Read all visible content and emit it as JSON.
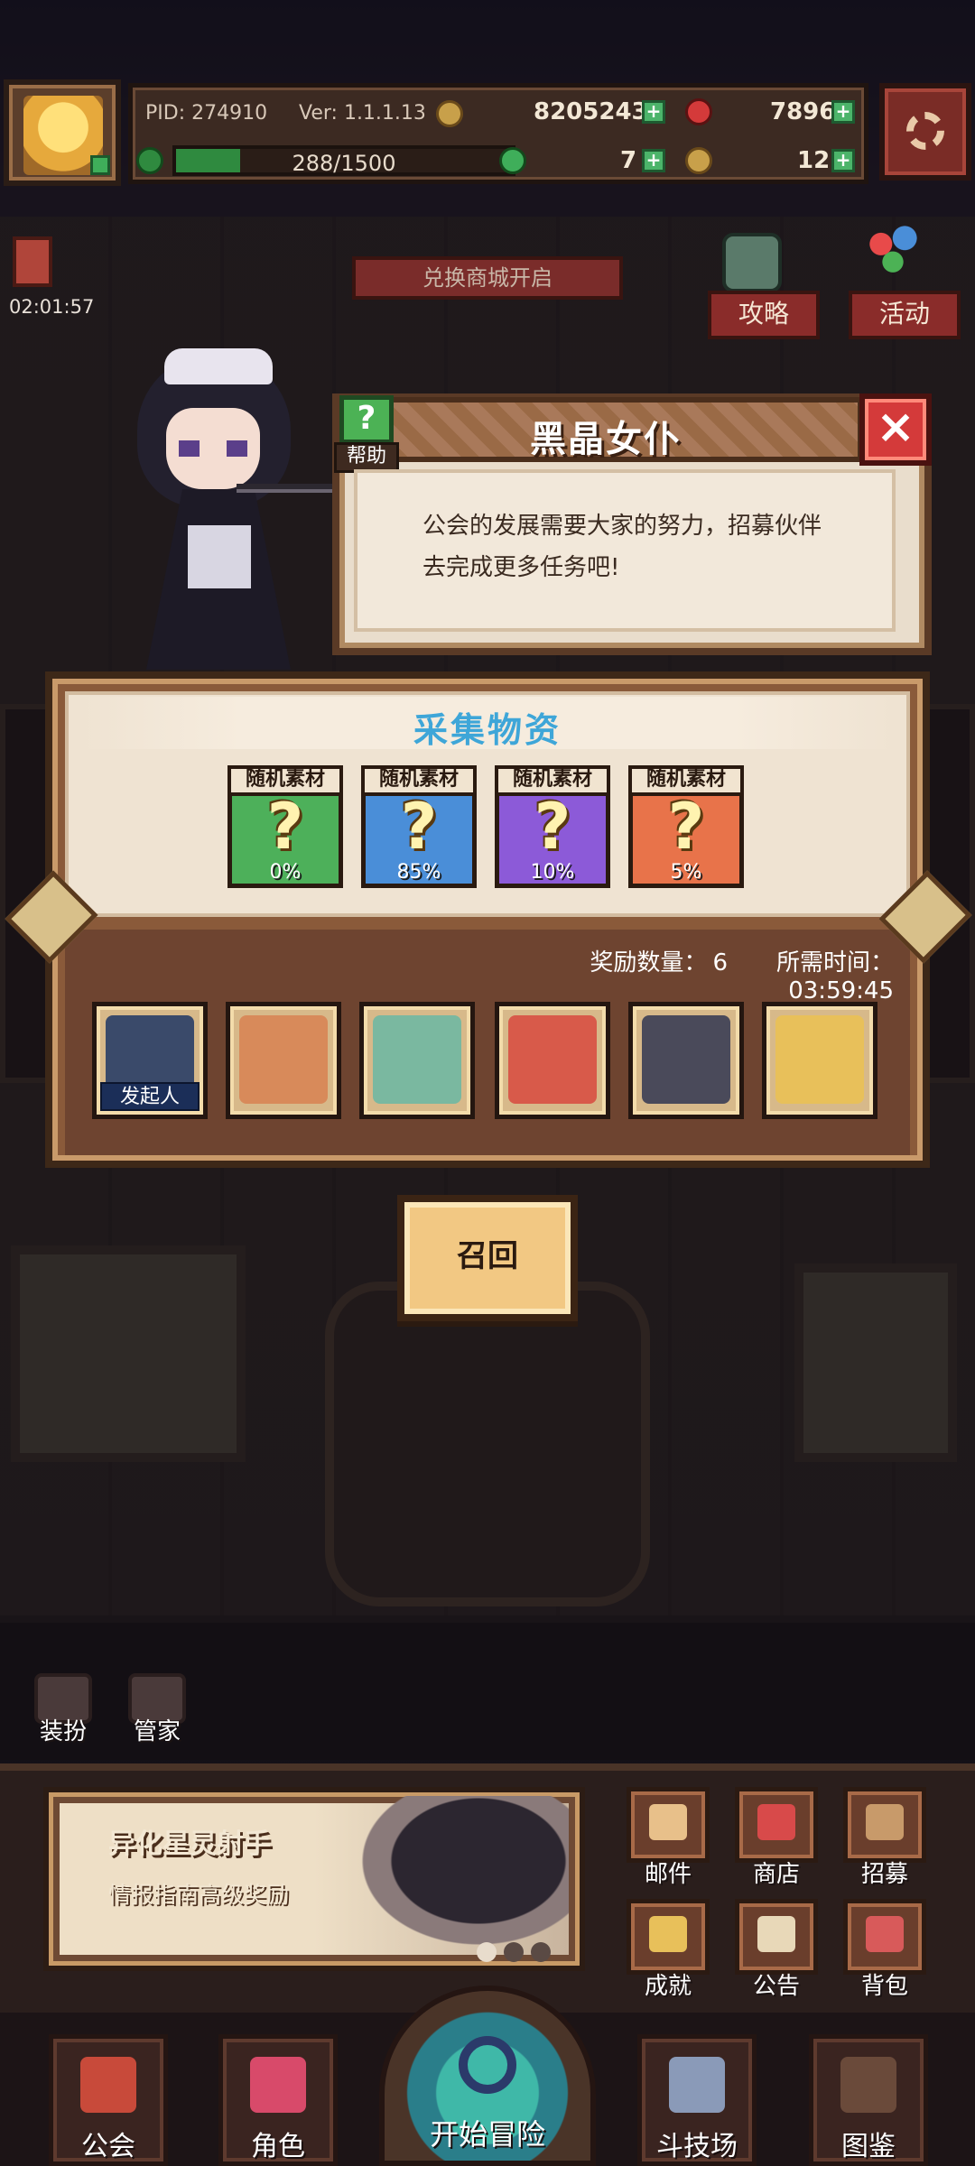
{
  "status_bar": {
    "pid": "PID: 274910",
    "version": "Ver: 1.1.1.13",
    "gold": "8205243",
    "gems": "7896",
    "stamina": "288/1500",
    "stamina_ratio": 0.192,
    "clover": "7",
    "keys": "12"
  },
  "scene": {
    "timer": "02:01:57",
    "event_banner": "兑换商城开启",
    "guide_label": "攻略",
    "activity_label": "活动"
  },
  "npc_dialog": {
    "help_label": "帮助",
    "npc_name": "黑晶女仆",
    "message_line1": "公会的发展需要大家的努力，招募伙伴",
    "message_line2": "去完成更多任务吧!",
    "close_icon": "×"
  },
  "gather_panel": {
    "title": "采集物资",
    "materials": [
      {
        "label": "随机素材",
        "symbol": "?",
        "chance": "0%",
        "color": "#4db05a"
      },
      {
        "label": "随机素材",
        "symbol": "?",
        "chance": "85%",
        "color": "#4a8ed8"
      },
      {
        "label": "随机素材",
        "symbol": "?",
        "chance": "10%",
        "color": "#8c5ad8"
      },
      {
        "label": "随机素材",
        "symbol": "?",
        "chance": "5%",
        "color": "#e8734a"
      }
    ],
    "reward_label": "奖励数量：",
    "reward_value": "6",
    "time_label": "所需时间：",
    "time_value": "03:59:45",
    "initiator_label": "发起人",
    "heroes": [
      {
        "color": "#3a4a6a"
      },
      {
        "color": "#d88a5a"
      },
      {
        "color": "#7ab8a0"
      },
      {
        "color": "#d85a4a"
      },
      {
        "color": "#4a4a5a"
      },
      {
        "color": "#e8c05a"
      }
    ]
  },
  "recall_button": "召回",
  "side_shortcuts": {
    "dress_label": "装扮",
    "butler_label": "管家"
  },
  "promo": {
    "title": "异化星灵射手",
    "subtitle": "情报指南高级奖励"
  },
  "functions": {
    "mail": "邮件",
    "shop": "商店",
    "recruit": "招募",
    "achievement": "成就",
    "notice": "公告",
    "bag": "背包"
  },
  "nav": {
    "guild": "公会",
    "character": "角色",
    "start": "开始冒险",
    "arena": "斗技场",
    "codex": "图鉴"
  },
  "colors": {
    "accent_blue": "#3ea6d8",
    "close_red": "#d43a3a",
    "help_green": "#4cb255"
  }
}
